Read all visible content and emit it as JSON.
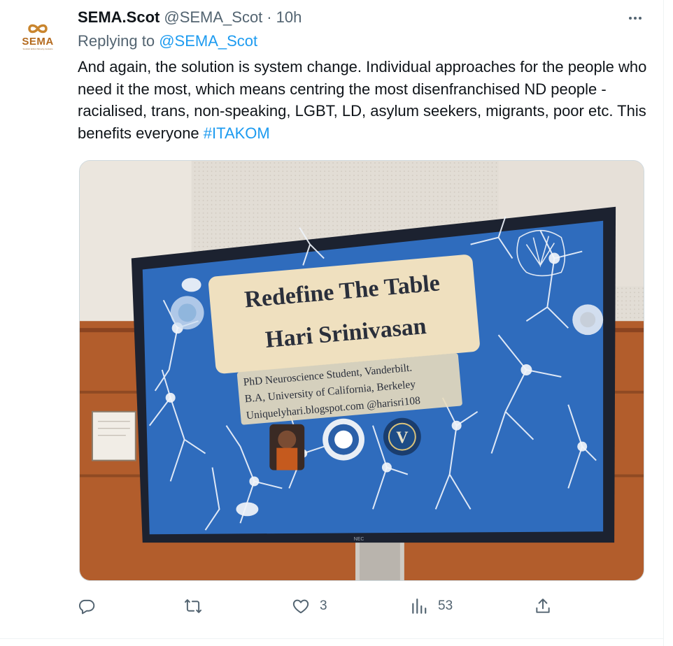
{
  "tweet": {
    "author_name": "SEMA.Scot",
    "author_handle": "@SEMA_Scot",
    "separator": "·",
    "time": "10h",
    "replying_prefix": "Replying to",
    "replying_to": "@SEMA_Scot",
    "text": "And again, the solution is system change. Individual approaches for the people who need it the most, which means centring the most disenfranchised ND people - racialised, trans, non-speaking, LGBT, LD, asylum seekers, migrants, poor etc. This benefits everyone",
    "hashtag": "#ITAKOM"
  },
  "avatar": {
    "brand": "SEMA",
    "tagline": "Scottish Ethnic Minority Autistics"
  },
  "slide": {
    "title": "Redefine The Table",
    "presenter": "Hari Srinivasan",
    "credit_lines": [
      "PhD Neuroscience Student, Vanderbilt.",
      "B.A, University of California, Berkeley",
      "Uniquelyhari.blogspot.com @harisri108"
    ],
    "tv_brand": "NEC",
    "seal_letter": "V"
  },
  "actions": {
    "reply_count": "",
    "retweet_count": "",
    "like_count": "3",
    "views_count": "53",
    "icons": [
      "reply-icon",
      "retweet-icon",
      "like-icon",
      "views-icon",
      "share-icon"
    ]
  },
  "colors": {
    "link": "#1d9bf0",
    "secondary_text": "#536471",
    "slide_blue": "#2f6cbd"
  }
}
